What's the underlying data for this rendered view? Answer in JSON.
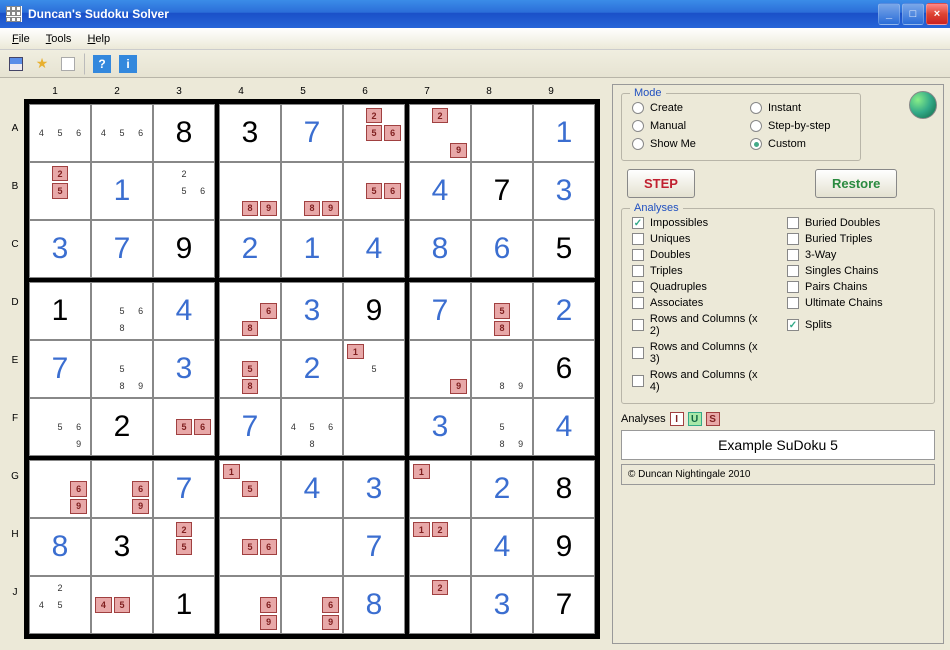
{
  "window": {
    "title": "Duncan's Sudoku Solver"
  },
  "menu": {
    "file": "File",
    "tools": "Tools",
    "help": "Help"
  },
  "cols": [
    "1",
    "2",
    "3",
    "4",
    "5",
    "6",
    "7",
    "8",
    "9"
  ],
  "rows": [
    "A",
    "B",
    "C",
    "D",
    "E",
    "F",
    "G",
    "H",
    "J"
  ],
  "grid": [
    [
      {
        "type": "cand",
        "v": [
          "",
          "",
          "",
          "4",
          "5",
          "6",
          "",
          "",
          ""
        ]
      },
      {
        "type": "cand",
        "v": [
          "",
          "",
          "",
          "4",
          "5",
          "6",
          "",
          "",
          ""
        ]
      },
      {
        "type": "big",
        "v": "8",
        "c": "black"
      },
      {
        "type": "big",
        "v": "3",
        "c": "black"
      },
      {
        "type": "big",
        "v": "7",
        "c": "blue"
      },
      {
        "type": "cand",
        "v": [
          "",
          "2r",
          "",
          "",
          "5r",
          "6r",
          "",
          "",
          ""
        ]
      },
      {
        "type": "cand",
        "v": [
          "",
          "2r",
          "",
          "",
          "",
          "",
          "",
          "",
          "9r"
        ]
      },
      {
        "type": "cand",
        "v": [
          "",
          "",
          "",
          "",
          "",
          "",
          "",
          "",
          ""
        ]
      },
      {
        "type": "big",
        "v": "1",
        "c": "blue"
      }
    ],
    [
      {
        "type": "cand",
        "v": [
          "",
          "2r",
          "",
          "",
          "5r",
          "",
          "",
          "",
          ""
        ]
      },
      {
        "type": "big",
        "v": "1",
        "c": "blue"
      },
      {
        "type": "cand",
        "v": [
          "",
          "2",
          "",
          "",
          "5",
          "6",
          "",
          "",
          ""
        ]
      },
      {
        "type": "cand",
        "v": [
          "",
          "",
          "",
          "",
          "",
          "",
          "",
          "8r",
          "9r"
        ]
      },
      {
        "type": "cand",
        "v": [
          "",
          "",
          "",
          "",
          "",
          "",
          "",
          "8r",
          "9r"
        ]
      },
      {
        "type": "cand",
        "v": [
          "",
          "",
          "",
          "",
          "5r",
          "6r",
          "",
          "",
          ""
        ]
      },
      {
        "type": "big",
        "v": "4",
        "c": "blue"
      },
      {
        "type": "big",
        "v": "7",
        "c": "black"
      },
      {
        "type": "big",
        "v": "3",
        "c": "blue"
      }
    ],
    [
      {
        "type": "big",
        "v": "3",
        "c": "blue"
      },
      {
        "type": "big",
        "v": "7",
        "c": "blue"
      },
      {
        "type": "big",
        "v": "9",
        "c": "black"
      },
      {
        "type": "big",
        "v": "2",
        "c": "blue"
      },
      {
        "type": "big",
        "v": "1",
        "c": "blue"
      },
      {
        "type": "big",
        "v": "4",
        "c": "blue"
      },
      {
        "type": "big",
        "v": "8",
        "c": "blue"
      },
      {
        "type": "big",
        "v": "6",
        "c": "blue"
      },
      {
        "type": "big",
        "v": "5",
        "c": "black"
      }
    ],
    [
      {
        "type": "big",
        "v": "1",
        "c": "black"
      },
      {
        "type": "cand",
        "v": [
          "",
          "",
          "",
          "",
          "5",
          "6",
          "",
          "8",
          ""
        ]
      },
      {
        "type": "big",
        "v": "4",
        "c": "blue"
      },
      {
        "type": "cand",
        "v": [
          "",
          "",
          "",
          "",
          "",
          "6r",
          "",
          "8r",
          ""
        ]
      },
      {
        "type": "big",
        "v": "3",
        "c": "blue"
      },
      {
        "type": "big",
        "v": "9",
        "c": "black"
      },
      {
        "type": "big",
        "v": "7",
        "c": "blue"
      },
      {
        "type": "cand",
        "v": [
          "",
          "",
          "",
          "",
          "5r",
          "",
          "",
          "8r",
          ""
        ]
      },
      {
        "type": "big",
        "v": "2",
        "c": "blue"
      }
    ],
    [
      {
        "type": "big",
        "v": "7",
        "c": "blue"
      },
      {
        "type": "cand",
        "v": [
          "",
          "",
          "",
          "",
          "5",
          "",
          "",
          "8",
          "9"
        ]
      },
      {
        "type": "big",
        "v": "3",
        "c": "blue"
      },
      {
        "type": "cand",
        "v": [
          "",
          "",
          "",
          "",
          "5r",
          "",
          "",
          "8r",
          ""
        ]
      },
      {
        "type": "big",
        "v": "2",
        "c": "blue"
      },
      {
        "type": "cand",
        "v": [
          "1r",
          "",
          "",
          "",
          "5",
          "",
          "",
          "",
          ""
        ]
      },
      {
        "type": "cand",
        "v": [
          "",
          "",
          "",
          "",
          "",
          "",
          "",
          "",
          "9r"
        ]
      },
      {
        "type": "cand",
        "v": [
          "",
          "",
          "",
          "",
          "",
          "",
          "",
          "8",
          "9"
        ]
      },
      {
        "type": "big",
        "v": "6",
        "c": "black"
      }
    ],
    [
      {
        "type": "cand",
        "v": [
          "",
          "",
          "",
          "",
          "5",
          "6",
          "",
          "",
          "9"
        ]
      },
      {
        "type": "big",
        "v": "2",
        "c": "black"
      },
      {
        "type": "cand",
        "v": [
          "",
          "",
          "",
          "",
          "5r",
          "6r",
          "",
          "",
          ""
        ]
      },
      {
        "type": "big",
        "v": "7",
        "c": "blue"
      },
      {
        "type": "cand",
        "v": [
          "",
          "",
          "",
          "4",
          "5",
          "6",
          "",
          "8",
          ""
        ]
      },
      {
        "type": "cand",
        "v": [
          "",
          "",
          "",
          "",
          "",
          "",
          "",
          "",
          ""
        ]
      },
      {
        "type": "big",
        "v": "3",
        "c": "blue"
      },
      {
        "type": "cand",
        "v": [
          "",
          "",
          "",
          "",
          "5",
          "",
          "",
          "8",
          "9"
        ]
      },
      {
        "type": "big",
        "v": "4",
        "c": "blue"
      }
    ],
    [
      {
        "type": "cand",
        "v": [
          "",
          "",
          "",
          "",
          "",
          "6r",
          "",
          "",
          "9r"
        ]
      },
      {
        "type": "cand",
        "v": [
          "",
          "",
          "",
          "",
          "",
          "6r",
          "",
          "",
          "9r"
        ]
      },
      {
        "type": "big",
        "v": "7",
        "c": "blue"
      },
      {
        "type": "cand",
        "v": [
          "1r",
          "",
          "",
          "",
          "5r",
          "",
          "",
          "",
          ""
        ]
      },
      {
        "type": "big",
        "v": "4",
        "c": "blue"
      },
      {
        "type": "big",
        "v": "3",
        "c": "blue"
      },
      {
        "type": "cand",
        "v": [
          "1r",
          "",
          "",
          "",
          "",
          "",
          "",
          "",
          ""
        ]
      },
      {
        "type": "big",
        "v": "2",
        "c": "blue"
      },
      {
        "type": "big",
        "v": "8",
        "c": "black"
      }
    ],
    [
      {
        "type": "big",
        "v": "8",
        "c": "blue"
      },
      {
        "type": "big",
        "v": "3",
        "c": "black"
      },
      {
        "type": "cand",
        "v": [
          "",
          "2r",
          "",
          "",
          "5r",
          "",
          "",
          "",
          ""
        ]
      },
      {
        "type": "cand",
        "v": [
          "",
          "",
          "",
          "",
          "5r",
          "6r",
          "",
          "",
          ""
        ]
      },
      {
        "type": "cand",
        "v": [
          "",
          "",
          "",
          "",
          "",
          "",
          "",
          "",
          ""
        ]
      },
      {
        "type": "big",
        "v": "7",
        "c": "blue"
      },
      {
        "type": "cand",
        "v": [
          "1r",
          "2r",
          "",
          "",
          "",
          "",
          "",
          "",
          ""
        ]
      },
      {
        "type": "big",
        "v": "4",
        "c": "blue"
      },
      {
        "type": "big",
        "v": "9",
        "c": "black"
      }
    ],
    [
      {
        "type": "cand",
        "v": [
          "",
          "2",
          "",
          "4",
          "5",
          "",
          "",
          "",
          ""
        ]
      },
      {
        "type": "cand",
        "v": [
          "",
          "",
          "",
          "4r",
          "5r",
          "",
          "",
          "",
          ""
        ]
      },
      {
        "type": "big",
        "v": "1",
        "c": "black"
      },
      {
        "type": "cand",
        "v": [
          "",
          "",
          "",
          "",
          "",
          "6r",
          "",
          "",
          "9r"
        ]
      },
      {
        "type": "cand",
        "v": [
          "",
          "",
          "",
          "",
          "",
          "6r",
          "",
          "",
          "9r"
        ]
      },
      {
        "type": "big",
        "v": "8",
        "c": "blue"
      },
      {
        "type": "cand",
        "v": [
          "",
          "2r",
          "",
          "",
          "",
          "",
          "",
          "",
          ""
        ]
      },
      {
        "type": "big",
        "v": "3",
        "c": "blue"
      },
      {
        "type": "big",
        "v": "7",
        "c": "black"
      }
    ]
  ],
  "panel": {
    "mode": {
      "title": "Mode",
      "options": [
        {
          "label": "Create",
          "checked": false
        },
        {
          "label": "Instant",
          "checked": false
        },
        {
          "label": "Manual",
          "checked": false
        },
        {
          "label": "Step-by-step",
          "checked": false
        },
        {
          "label": "Show Me",
          "checked": false
        },
        {
          "label": "Custom",
          "checked": true
        }
      ]
    },
    "buttons": {
      "step": "STEP",
      "restore": "Restore"
    },
    "analyses": {
      "title": "Analyses",
      "items": [
        {
          "label": "Impossibles",
          "checked": true
        },
        {
          "label": "Buried Doubles",
          "checked": false
        },
        {
          "label": "Uniques",
          "checked": false
        },
        {
          "label": "Buried Triples",
          "checked": false
        },
        {
          "label": "Doubles",
          "checked": false
        },
        {
          "label": "3-Way",
          "checked": false
        },
        {
          "label": "Triples",
          "checked": false
        },
        {
          "label": "Singles Chains",
          "checked": false
        },
        {
          "label": "Quadruples",
          "checked": false
        },
        {
          "label": "Pairs Chains",
          "checked": false
        },
        {
          "label": "Associates",
          "checked": false
        },
        {
          "label": "Ultimate Chains",
          "checked": false
        },
        {
          "label": "Rows and Columns (x 2)",
          "checked": false
        },
        {
          "label": "Splits",
          "checked": true
        },
        {
          "label": "Rows and Columns (x 3)",
          "checked": false,
          "span": true
        },
        {
          "label": "Rows and Columns (x 4)",
          "checked": false,
          "span": true
        }
      ]
    },
    "badges_label": "Analyses",
    "badges": [
      "I",
      "U",
      "S"
    ],
    "status": "Example SuDoku 5",
    "copyright": "© Duncan Nightingale 2010"
  }
}
